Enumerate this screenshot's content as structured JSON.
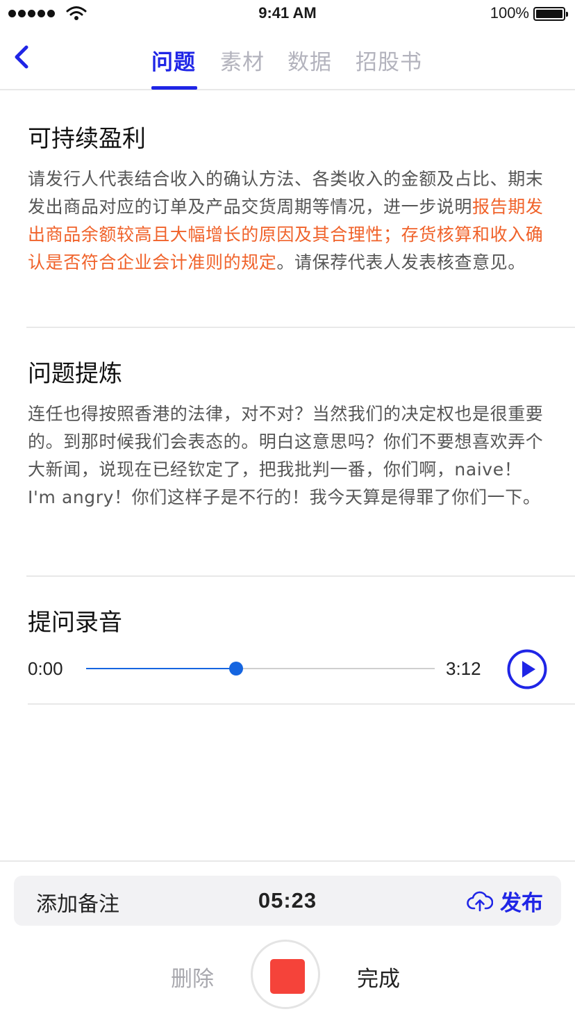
{
  "status_bar": {
    "time": "9:41 AM",
    "battery": "100%",
    "icons": [
      "signal-icon",
      "wifi-icon",
      "battery-icon"
    ]
  },
  "nav": {
    "back_icon": "chevron-left-icon",
    "tabs": [
      {
        "label": "问题",
        "active": true
      },
      {
        "label": "素材",
        "active": false
      },
      {
        "label": "数据",
        "active": false
      },
      {
        "label": "招股书",
        "active": false
      }
    ]
  },
  "question": {
    "title": "可持续盈利",
    "text_before": "请发行人代表结合收入的确认方法、各类收入的金额及占比、期末发出商品对应的订单及产品交货周期等情况，进一步说明",
    "text_highlight": "报告期发出商品余额较高且大幅增长的原因及其合理性；存货核算和收入确认是否符合企业会计准则的规定",
    "text_after": "。请保荐代表人发表核查意见。"
  },
  "refined": {
    "title": "问题提炼",
    "text": "连任也得按照香港的法律，对不对？当然我们的决定权也是很重要的。到那时候我们会表态的。明白这意思吗？你们不要想喜欢弄个大新闻，说现在已经钦定了，把我批判一番，你们啊，naive！ I'm angry！你们这样子是不行的！我今天算是得罪了你们一下。"
  },
  "recording": {
    "title": "提问录音",
    "current_time": "0:00",
    "total_time": "3:12",
    "progress": 0.43,
    "play_icon": "play-icon"
  },
  "bottom": {
    "add_note": "添加备注",
    "timer": "05:23",
    "publish": "发布",
    "publish_icon": "cloud-upload-icon",
    "delete": "删除",
    "done": "完成",
    "stop_icon": "stop-record-icon"
  },
  "colors": {
    "accent": "#1f25e6",
    "highlight": "#f0622a",
    "progress": "#1565e0",
    "record": "#f5433a"
  }
}
